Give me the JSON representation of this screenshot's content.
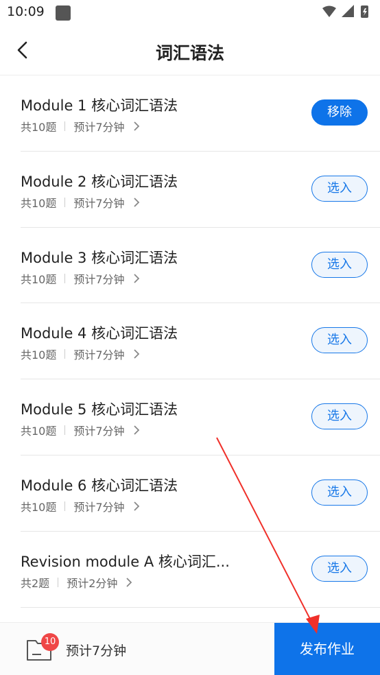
{
  "status_bar": {
    "time": "10:09"
  },
  "header": {
    "title": "词汇语法"
  },
  "items": [
    {
      "title": "Module 1 核心词汇语法",
      "count": "共10题",
      "duration": "预计7分钟",
      "action": "移除",
      "selected": true
    },
    {
      "title": "Module 2 核心词汇语法",
      "count": "共10题",
      "duration": "预计7分钟",
      "action": "选入",
      "selected": false
    },
    {
      "title": "Module 3 核心词汇语法",
      "count": "共10题",
      "duration": "预计7分钟",
      "action": "选入",
      "selected": false
    },
    {
      "title": "Module 4 核心词汇语法",
      "count": "共10题",
      "duration": "预计7分钟",
      "action": "选入",
      "selected": false
    },
    {
      "title": "Module 5 核心词汇语法",
      "count": "共10题",
      "duration": "预计7分钟",
      "action": "选入",
      "selected": false
    },
    {
      "title": "Module 6 核心词汇语法",
      "count": "共10题",
      "duration": "预计7分钟",
      "action": "选入",
      "selected": false
    },
    {
      "title": "Revision module A 核心词汇...",
      "count": "共2题",
      "duration": "预计2分钟",
      "action": "选入",
      "selected": false
    }
  ],
  "bottom_bar": {
    "badge_count": "10",
    "estimated_time": "预计7分钟",
    "publish_label": "发布作业"
  },
  "colors": {
    "accent": "#0e73e9",
    "badge": "#ef4747",
    "annotation_arrow": "#f0302a"
  }
}
